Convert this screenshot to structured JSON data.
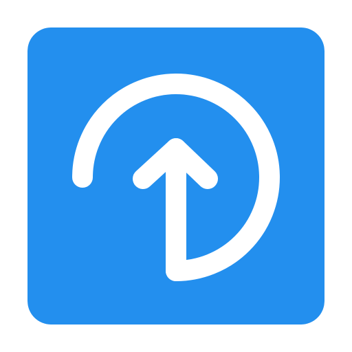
{
  "icon": {
    "name": "circular-upload-arrow-icon",
    "background_color": "#238FEE",
    "glyph_color": "#FFFFFF"
  }
}
